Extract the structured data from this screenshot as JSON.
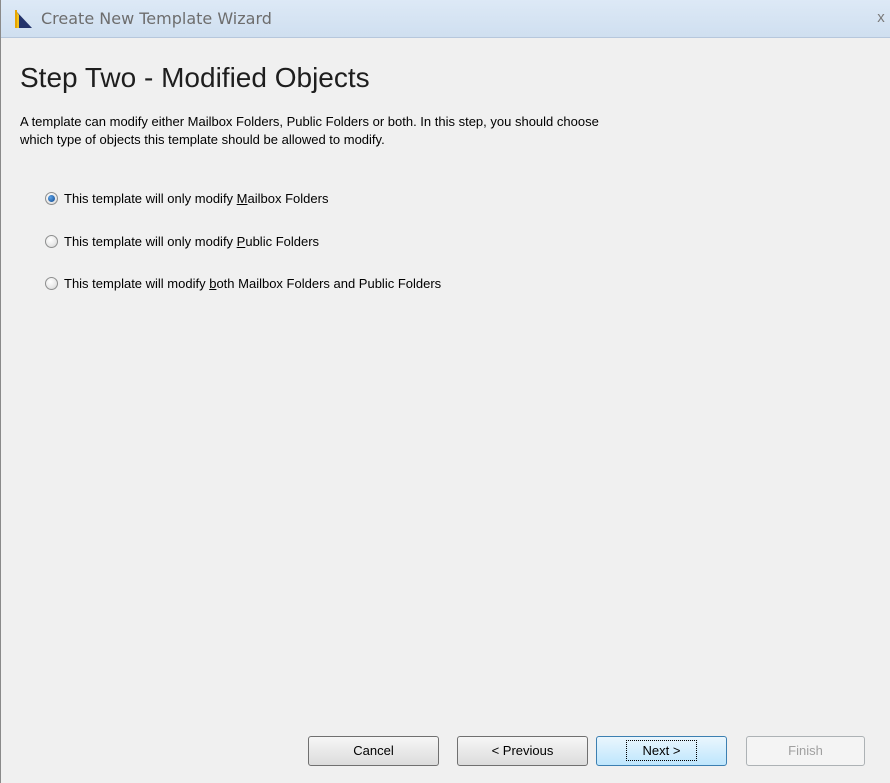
{
  "window": {
    "title": "Create New Template Wizard",
    "close_glyph": "x"
  },
  "page": {
    "heading": "Step Two - Modified Objects",
    "description_line1": "A template can modify either Mailbox Folders, Public Folders or both. In this step, you should choose",
    "description_line2": "which type of objects this template should be allowed to modify."
  },
  "options": [
    {
      "before": "This template will only modify ",
      "mnemonic": "M",
      "after": "ailbox Folders",
      "selected": true
    },
    {
      "before": "This template will only modify ",
      "mnemonic": "P",
      "after": "ublic Folders",
      "selected": false
    },
    {
      "before": "This template will modify ",
      "mnemonic": "b",
      "after": "oth Mailbox Folders and Public Folders",
      "selected": false
    }
  ],
  "buttons": {
    "cancel": "Cancel",
    "previous": "< Previous",
    "next": "Next >",
    "finish": "Finish"
  },
  "colors": {
    "accent": "#1f5aa0",
    "titlebar": "#dde9f6"
  }
}
